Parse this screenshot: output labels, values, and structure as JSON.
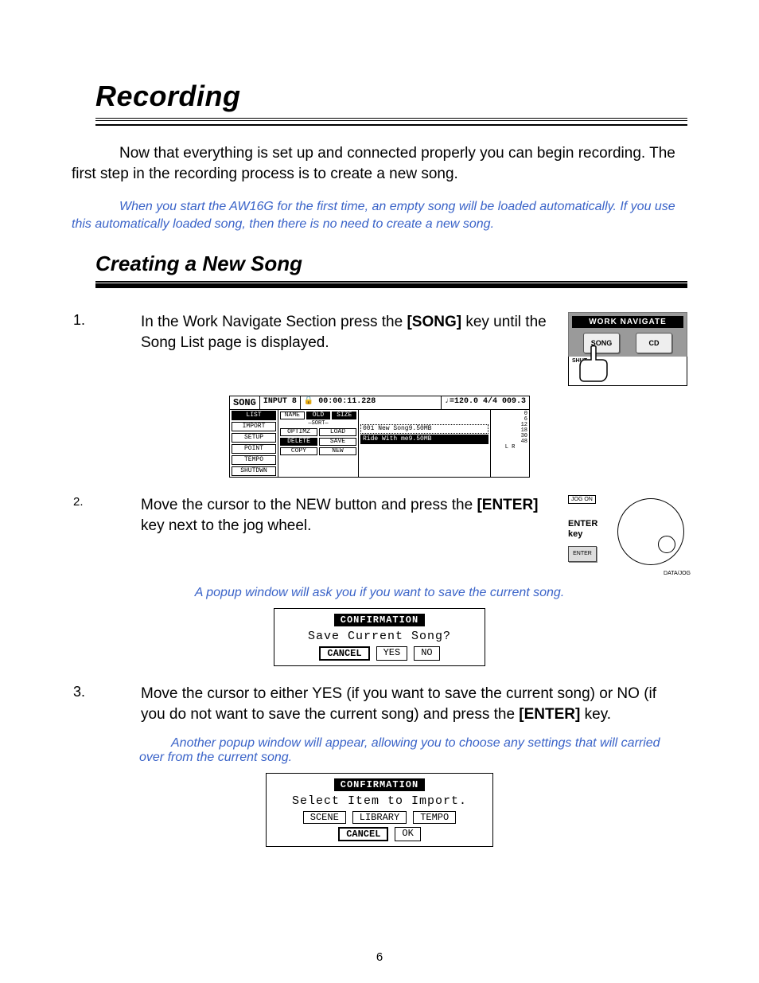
{
  "title": "Recording",
  "intro": "Now that everything is set up and connected properly you can begin recording.  The first step in the recording process is to create a new song.",
  "note1": "When you start the AW16G for the first time, an empty song will be loaded automatically.  If you use this automatically loaded song, then there is no need to create a new song.",
  "section_title": "Creating a New Song",
  "steps": {
    "s1": {
      "num": "1.",
      "text_a": "In the Work Navigate Section press the ",
      "bold": "[SONG]",
      "text_b": " key until the Song List page is displayed."
    },
    "s2": {
      "num": "2.",
      "text_a": "Move the cursor to the NEW button and press the ",
      "bold": "[ENTER]",
      "text_b": " key next to the jog wheel."
    },
    "s3": {
      "num": "3.",
      "text_a": "Move the cursor to either YES (if you want to save the current song) or NO (if you do not want to save the current song) and press the ",
      "bold": "[ENTER]",
      "text_b": " key."
    }
  },
  "worknav": {
    "title": "WORK NAVIGATE",
    "btn_song": "SONG",
    "btn_cd": "CD",
    "shut": "SHUT"
  },
  "lcd": {
    "header_song": "SONG",
    "header_input": "INPUT 8",
    "header_time": "00:00:11.228",
    "header_tempo": "♩=120.0 4/4 009.3",
    "tabs": [
      "LIST",
      "IMPORT",
      "SETUP",
      "POINT",
      "TEMPO",
      "SHUTDWN"
    ],
    "sort_label": "SORT",
    "btns_top": [
      "NAME",
      "OLD",
      "SIZE"
    ],
    "btns": [
      [
        "OPTIMZ",
        "LOAD"
      ],
      [
        "DELETE",
        "SAVE"
      ],
      [
        "COPY",
        "NEW"
      ]
    ],
    "rows": [
      "001  New Song9.50MB",
      "Ride With me9.50MB"
    ],
    "meter": [
      "0",
      "6",
      "12",
      "18",
      "30",
      "48"
    ],
    "meter_lr": "L R"
  },
  "jog": {
    "top_label": "JOG ON",
    "enter": "ENTER",
    "key": "key",
    "btn": "ENTER",
    "caption": "DATA/JOG"
  },
  "popup_note": "A popup window will ask you if you want to save the current song.",
  "popup1": {
    "title": "CONFIRMATION",
    "msg": "Save Current Song?",
    "btns": [
      "CANCEL",
      "YES",
      "NO"
    ]
  },
  "popup2_note": "Another popup window will appear, allowing you to choose any settings that will carried over from the current song.",
  "popup2": {
    "title": "CONFIRMATION",
    "msg": "Select Item to Import.",
    "row1": [
      "SCENE",
      "LIBRARY",
      "TEMPO"
    ],
    "row2": [
      "CANCEL",
      "OK"
    ]
  },
  "page_number": "6"
}
